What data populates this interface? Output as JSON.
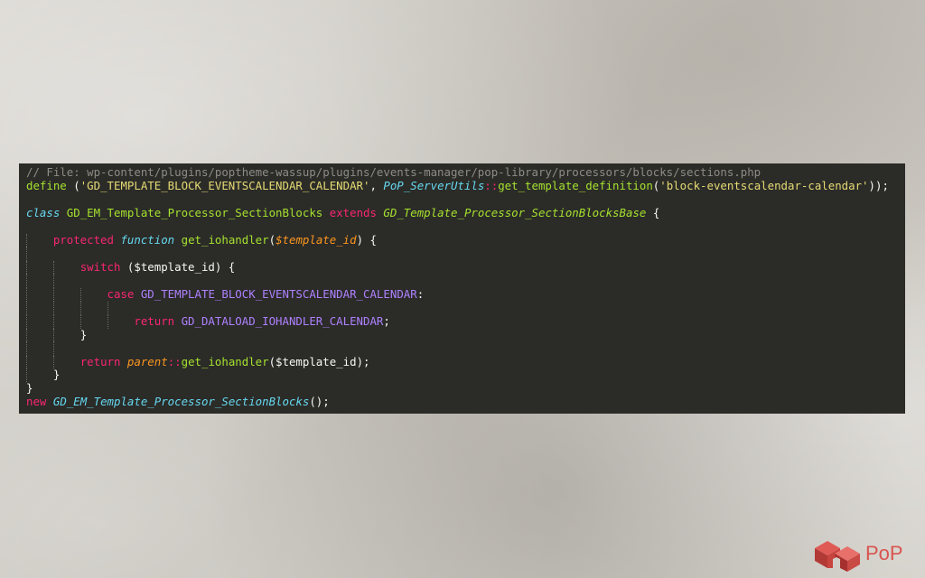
{
  "code": {
    "comment_line": "// File: wp-content/plugins/poptheme-wassup/plugins/events-manager/pop-library/processors/blocks/sections.php",
    "define_kw": "define",
    "define_open": " (",
    "define_const": "'GD_TEMPLATE_BLOCK_EVENTSCALENDAR_CALENDAR'",
    "define_comma": ", ",
    "define_class": "PoP_ServerUtils",
    "define_scope": "::",
    "define_fn": "get_template_definition",
    "define_paren": "(",
    "define_arg": "'block-eventscalendar-calendar'",
    "define_close": "));",
    "class_kw": "class",
    "class_name": "GD_EM_Template_Processor_SectionBlocks",
    "extends_kw": "extends",
    "parent_class": "GD_Template_Processor_SectionBlocksBase",
    "class_open": " {",
    "protected_kw": "protected",
    "function_kw": "function",
    "method_name": "get_iohandler",
    "method_open": "(",
    "method_param": "$template_id",
    "method_close": ") {",
    "switch_kw": "switch",
    "switch_expr": " ($template_id) {",
    "case_kw": "case",
    "case_const": "GD_TEMPLATE_BLOCK_EVENTSCALENDAR_CALENDAR",
    "case_colon": ":",
    "return_kw": "return",
    "return_const": "GD_DATALOAD_IOHANDLER_CALENDAR",
    "semicolon": ";",
    "close_brace": "}",
    "parent_kw": "parent",
    "parent_scope": "::",
    "parent_call": "get_iohandler",
    "parent_args": "($template_id);",
    "new_kw": "new",
    "new_class": "GD_EM_Template_Processor_SectionBlocks",
    "new_end": "();"
  },
  "logo": {
    "text": "PoP",
    "icon": "pop-logo-icon",
    "color": "#d9534f"
  },
  "theme": {
    "background": "#2b2b28",
    "comment": "#8d8c84",
    "keyword": "#f92672",
    "storage": "#66d9ef",
    "entity": "#a6e22e",
    "string": "#e6db74",
    "parameter": "#fd971f",
    "constant": "#ae81ff"
  }
}
